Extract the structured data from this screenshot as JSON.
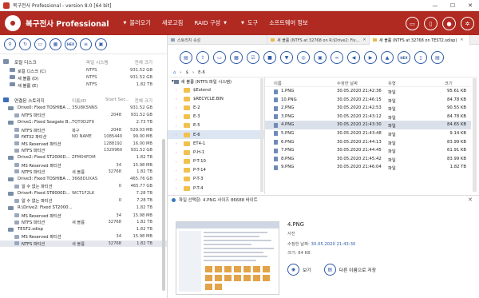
{
  "titlebar": {
    "title": "복구전사 Professional - version 8.0 [64 bit]",
    "min": "—",
    "max": "☐",
    "close": "✕"
  },
  "menubar": {
    "brand": "복구전사 Professional",
    "items": [
      "불러오기",
      "새로고침",
      "RAID 구성",
      "도구",
      "소프트웨어 정보"
    ],
    "caret": "▼",
    "accent": "#b02a22"
  },
  "left": {
    "local_section": {
      "title": "로컬 디스크",
      "col2": "파일 시스템",
      "col3": "전체 크기"
    },
    "local_rows": [
      {
        "name": "로컬 디스크 (C)",
        "fs": "NTFS",
        "size": "931.52 GB"
      },
      {
        "name": "새 볼륨 (D)",
        "fs": "NTFS",
        "size": "931.52 GB"
      },
      {
        "name": "새 볼륨 (E)",
        "fs": "NTFS",
        "size": "1.82 TB"
      }
    ],
    "storage_section": {
      "title": "연결된 스토리지",
      "col2": "이름/ID",
      "col3": "Start Sec..",
      "col4": "전체 크기"
    },
    "drives": [
      {
        "name": "Drive0: Fixed TOSHIBA ...",
        "serial": "35U8K5NNS",
        "size": "931.52 GB",
        "parts": [
          {
            "name": "NTFS 파티션",
            "label": "",
            "start": "2048",
            "size": "931.52 GB"
          }
        ]
      },
      {
        "name": "Drive1: Fixed Seagate B...",
        "serial": "TQT0D2F9",
        "size": "2.73 TB",
        "parts": [
          {
            "name": "NTFS 파티션",
            "label": "복구",
            "start": "2048",
            "size": "529.03 MB"
          },
          {
            "name": "FAT32 파티션",
            "label": "NO NAME",
            "start": "1085440",
            "size": "99.00 MB"
          },
          {
            "name": "MS Reserved 파티션",
            "label": "",
            "start": "1288192",
            "size": "16.00 MB"
          },
          {
            "name": "NTFS 파티션",
            "label": "",
            "start": "1320960",
            "size": "931.52 GB"
          }
        ]
      },
      {
        "name": "Drive2: Fixed ST2000D...",
        "serial": "ZFM04FDM",
        "size": "1.82 TB",
        "parts": [
          {
            "name": "MS Reserved 파티션",
            "label": "",
            "start": "34",
            "size": "15.98 MB"
          },
          {
            "name": "NTFS 파티션",
            "label": "새 볼륨",
            "start": "32768",
            "size": "1.82 TB"
          }
        ]
      },
      {
        "name": "Drive3: Fixed TOSHIBA ...",
        "serial": "3668DUXAS",
        "size": "465.76 GB",
        "parts": [
          {
            "name": "알 수 없는 파티션",
            "label": "",
            "start": "0",
            "size": "465.77 GB"
          }
        ]
      },
      {
        "name": "Drive4: Fixed ST8000D...",
        "serial": "WCT1F2LK",
        "size": "7.28 TB",
        "parts": [
          {
            "name": "알 수 없는 파티션",
            "label": "",
            "start": "0",
            "size": "7.28 TB"
          }
        ]
      },
      {
        "name": "R:\\Drive2: Fixed ST2000...",
        "serial": "",
        "size": "1.82 TB",
        "parts": [
          {
            "name": "MS Reserved 파티션",
            "label": "",
            "start": "34",
            "size": "15.98 MB"
          },
          {
            "name": "NTFS 파티션",
            "label": "새 볼륨",
            "start": "32768",
            "size": "1.82 TB"
          }
        ]
      },
      {
        "name": "TEST2.sdisp",
        "serial": "",
        "size": "1.82 TB",
        "parts": [
          {
            "name": "MS Reserved 파티션",
            "label": "",
            "start": "34",
            "size": "15.98 MB"
          },
          {
            "name": "NTFS 파티션",
            "label": "새 볼륨",
            "start": "32768",
            "size": "1.82 TB"
          }
        ]
      }
    ]
  },
  "tabs": [
    {
      "label": "스토리지 속성",
      "x": ""
    },
    {
      "label": "새 볼륨 (NTFS at 32768 on R:\\Drive2: Fix...",
      "x": "✕"
    },
    {
      "label": "새 볼륨 (NTFS at 32768 on TEST2.sdisp)",
      "x": "✕"
    }
  ],
  "toolbar_right": {
    "icons": [
      "save-icon",
      "export-icon",
      "folder-open-icon",
      "grid-icon",
      "checklist-icon",
      "stop-icon",
      "filter-icon",
      "scan-icon",
      "select-icon",
      "binoculars-icon",
      "back-icon",
      "forward-icon",
      "up-icon",
      "hex",
      "doc-icon",
      "report-icon"
    ],
    "hex": "HEX"
  },
  "path": {
    "root": "$",
    "sep": "›",
    "folder": "E-6"
  },
  "tree": {
    "root": "새 볼륨 (NTFS 파일 시스템)",
    "nodes": [
      "$Extend",
      "$RECYCLE.BIN",
      "E-2",
      "E-3",
      "E-5",
      "E-6",
      "ET4-1",
      "P-H-1",
      "P-T-10",
      "P-T-14",
      "P-T-3",
      "P-T-4"
    ],
    "selected": "E-6"
  },
  "list": {
    "headers": {
      "name": "이름",
      "date": "수정한 날짜",
      "type": "유형",
      "size": "크기"
    },
    "rows": [
      {
        "name": "1.PNG",
        "date": "30.05.2020 21:42:36",
        "type": "파일",
        "size": "95.61 KB"
      },
      {
        "name": "10.PNG",
        "date": "30.05.2020 21:46:15",
        "type": "파일",
        "size": "84.78 KB"
      },
      {
        "name": "2.PNG",
        "date": "30.05.2020 21:42:53",
        "type": "파일",
        "size": "90.55 KB"
      },
      {
        "name": "3.PNG",
        "date": "30.05.2020 21:43:12",
        "type": "파일",
        "size": "84.78 KB"
      },
      {
        "name": "4.PNG",
        "date": "30.05.2020 21:43:30",
        "type": "파일",
        "size": "84.65 KB"
      },
      {
        "name": "5.PNG",
        "date": "30.05.2020 21:43:48",
        "type": "파일",
        "size": "9.14 KB"
      },
      {
        "name": "6.PNG",
        "date": "30.05.2020 21:44:13",
        "type": "파일",
        "size": "83.99 KB"
      },
      {
        "name": "7.PNG",
        "date": "30.05.2020 21:44:45",
        "type": "파일",
        "size": "61.91 KB"
      },
      {
        "name": "8.PNG",
        "date": "30.05.2020 21:45:42",
        "type": "파일",
        "size": "83.99 KB"
      },
      {
        "name": "9.PNG",
        "date": "30.05.2020 21:46:04",
        "type": "파일",
        "size": "1.82 TB"
      }
    ],
    "selected": "4.PNG"
  },
  "status": {
    "text": "파일 선택함: 4.PNG 사이즈 86688 바이트",
    "close": "✕"
  },
  "preview": {
    "filename": "4.PNG",
    "type": "사진",
    "modified_label": "수정한 날짜:",
    "modified": "30.05.2020 21:43:30",
    "size_label": "크기:",
    "size": "84 KB",
    "view_label": "보기",
    "save_label": "다른 이름으로 저장"
  }
}
